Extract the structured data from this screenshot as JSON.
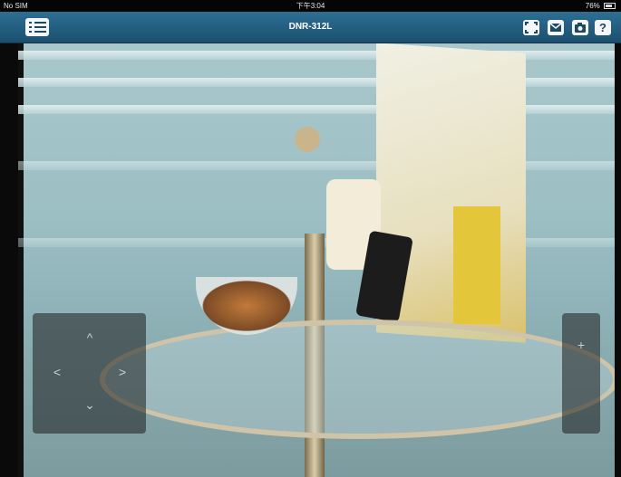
{
  "status_bar": {
    "carrier": "No SIM",
    "time": "下午3:04",
    "battery": "76%"
  },
  "header": {
    "title": "DNR-312L"
  },
  "icons": {
    "menu": "list-menu-icon",
    "fullscreen": "fullscreen-icon",
    "mail": "mail-icon",
    "snapshot": "camera-icon",
    "help": "help-icon"
  },
  "header_buttons": {
    "help_label": "?"
  },
  "ptz": {
    "up": "^",
    "down": "⌄",
    "left": "<",
    "right": ">",
    "zoom_in": "+"
  },
  "colors": {
    "header": "#24607f",
    "header_button_bg": "#f4f6f8"
  }
}
